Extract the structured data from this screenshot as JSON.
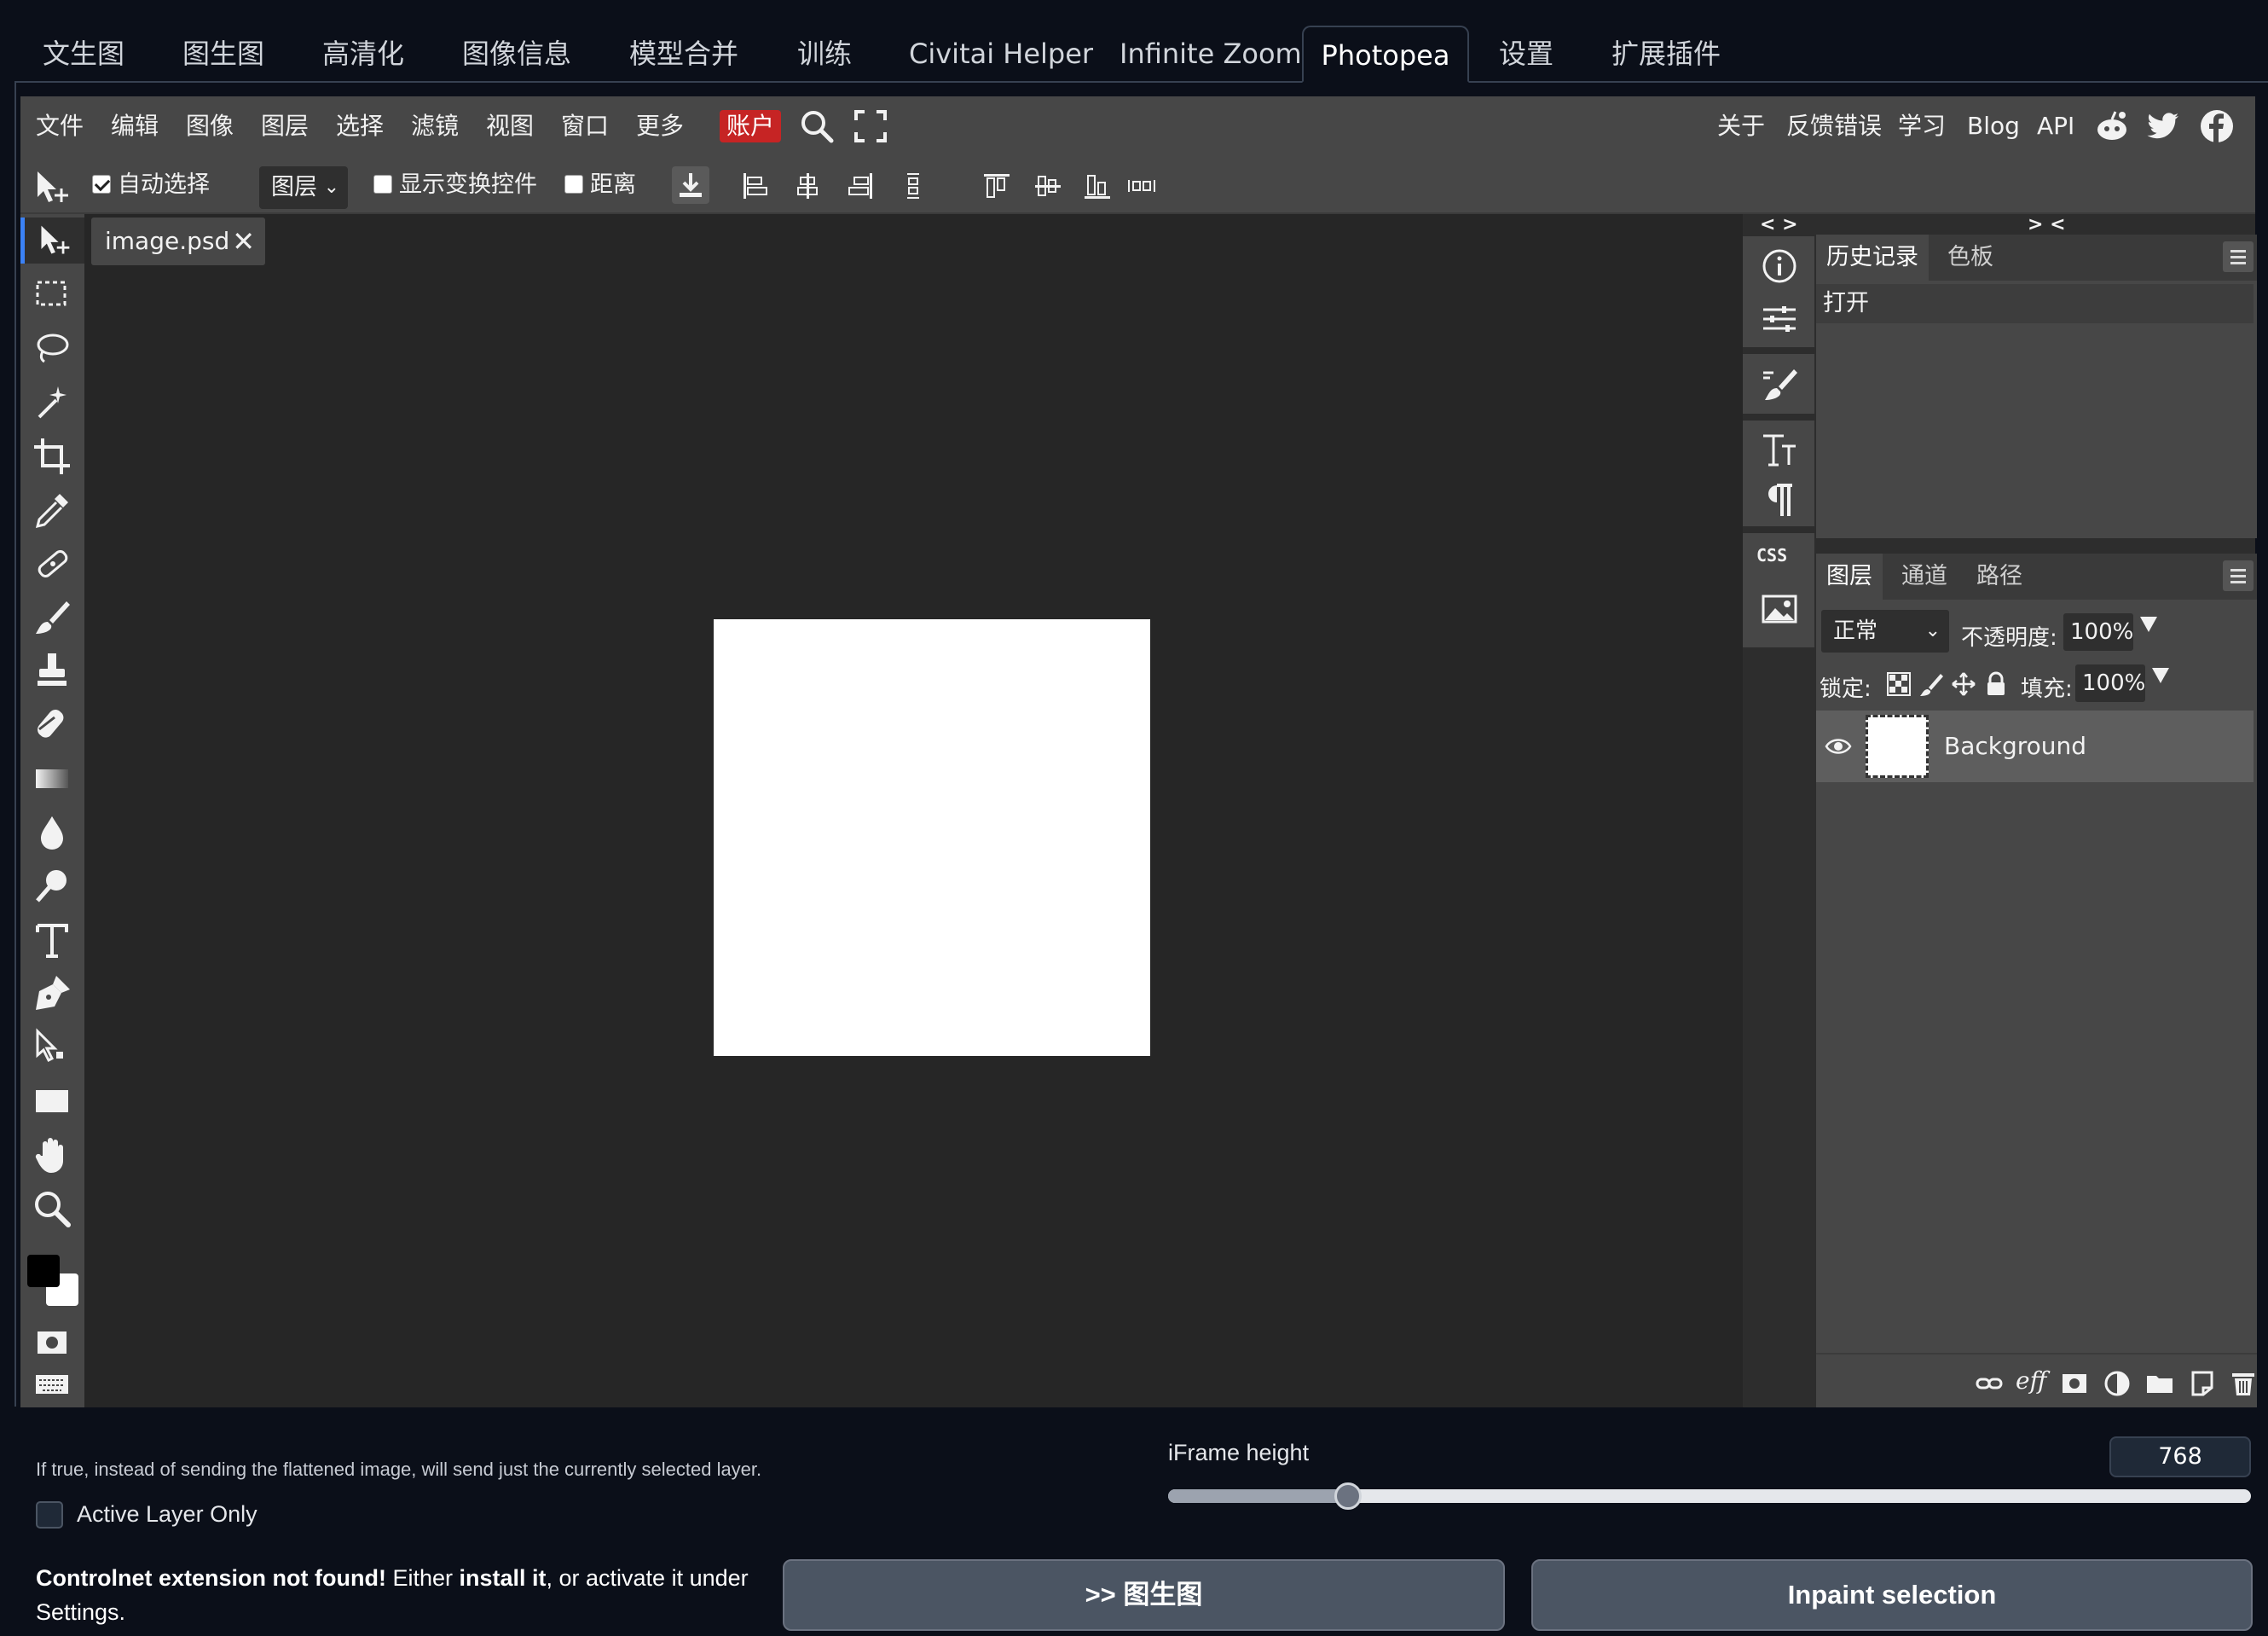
{
  "top_tabs": [
    "文生图",
    "图生图",
    "高清化",
    "图像信息",
    "模型合并",
    "训练",
    "Civitai Helper",
    "Infinite Zoom",
    "Photopea",
    "设置",
    "扩展插件"
  ],
  "active_tab": "Photopea",
  "photopea": {
    "menu": [
      "文件",
      "编辑",
      "图像",
      "图层",
      "选择",
      "滤镜",
      "视图",
      "窗口",
      "更多"
    ],
    "account": "账户",
    "menu_right": [
      "关于",
      "反馈错误",
      "学习",
      "Blog",
      "API"
    ],
    "options": {
      "auto_select_label": "自动选择",
      "auto_select_checked": true,
      "layer_dropdown": "图层",
      "show_transform_label": "显示变换控件",
      "show_transform_checked": false,
      "distance_label": "距离",
      "distance_checked": false
    },
    "document_tab": "image.psd",
    "history_panel": {
      "tabs": [
        "历史记录",
        "色板"
      ],
      "items": [
        "打开"
      ]
    },
    "panel_collapse": {
      "left": "< >",
      "right": "> <"
    },
    "layers_panel": {
      "tabs": [
        "图层",
        "通道",
        "路径"
      ],
      "blend_mode": "正常",
      "opacity_label": "不透明度:",
      "opacity": "100%",
      "lock_label": "锁定:",
      "fill_label": "填充:",
      "fill": "100%",
      "layers": [
        {
          "name": "Background",
          "visible": true
        }
      ]
    },
    "icons": {
      "menu": [
        "search-icon",
        "fullscreen-icon",
        "reddit-icon",
        "twitter-icon",
        "facebook-icon"
      ],
      "tools": [
        "move-tool-icon",
        "marquee-icon",
        "lasso-icon",
        "magic-wand-icon",
        "crop-icon",
        "eyedropper-icon",
        "healing-brush-icon",
        "brush-icon",
        "clone-stamp-icon",
        "eraser-icon",
        "gradient-icon",
        "blur-icon",
        "dodge-icon",
        "text-icon",
        "pen-icon",
        "path-select-icon",
        "rectangle-icon",
        "hand-icon",
        "zoom-icon"
      ],
      "strip": [
        "info-icon",
        "adjustments-icon",
        "brush-settings-icon",
        "character-icon",
        "paragraph-icon",
        "css-icon",
        "image-icon"
      ],
      "layer_footer": [
        "link-icon",
        "effects-icon",
        "mask-icon",
        "adjustment-layer-icon",
        "folder-icon",
        "new-layer-icon",
        "delete-icon"
      ]
    },
    "colors": {
      "foreground": "#000000",
      "background": "#ffffff",
      "account_button": "#c62424"
    }
  },
  "bottom": {
    "hint": "If true, instead of sending the flattened image, will send just the currently selected layer.",
    "active_layer_only_label": "Active Layer Only",
    "active_layer_only_checked": false,
    "iframe_height_label": "iFrame height",
    "iframe_height": "768",
    "iframe_height_fraction": 0.166,
    "warning_bold": "Controlnet extension not found!",
    "warning_mid": " Either ",
    "warning_link": "install it",
    "warning_end": ", or activate it under Settings.",
    "send_button": ">> 图生图",
    "inpaint_button": "Inpaint selection"
  }
}
